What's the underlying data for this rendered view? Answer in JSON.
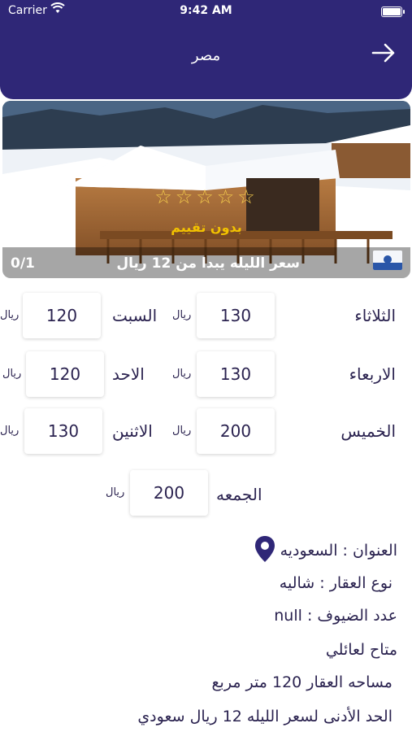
{
  "status": {
    "carrier": "Carrier",
    "time": "9:42 AM"
  },
  "header": {
    "title": "مصر"
  },
  "hero": {
    "stars": "☆☆☆☆☆",
    "rating_text": "بدون تقييم",
    "price_caption": "سعر الليله يبدا من 12 ريال",
    "counter": "0/1"
  },
  "unit": "ريال",
  "days_right": [
    {
      "day": "الثلاثاء",
      "price": "130"
    },
    {
      "day": "الاربعاء",
      "price": "130"
    },
    {
      "day": "الخميس",
      "price": "200"
    },
    {
      "day": "الجمعه",
      "price": "200"
    }
  ],
  "days_left": [
    {
      "day": "السبت",
      "price": "120"
    },
    {
      "day": "الاحد",
      "price": "120"
    },
    {
      "day": "الاثنين",
      "price": "130"
    }
  ],
  "info": {
    "address": "العنوان : السعوديه",
    "property_type": "نوع العقار : شاليه",
    "guests": "عدد الضيوف : null",
    "availability": "متاح لعائلي",
    "area": "مساحه العقار 120 متر مربع",
    "min_price": "الحد الأدنى لسعر الليله 12 ريال سعودي"
  },
  "colors": {
    "header": "#2f2777",
    "star": "#f2c94c",
    "pin": "#2f2777"
  }
}
